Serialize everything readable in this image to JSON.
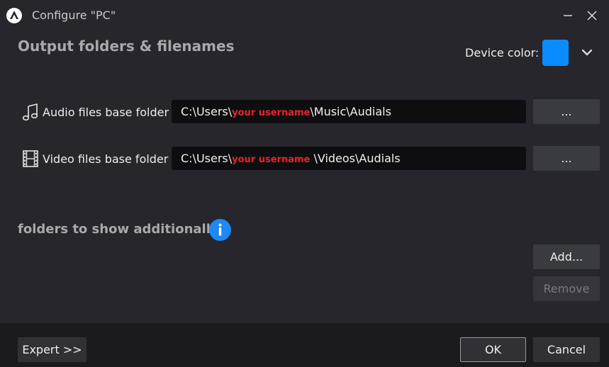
{
  "window": {
    "title": "Configure \"PC\"",
    "minimize_icon": "minimize-icon",
    "close_icon": "close-icon"
  },
  "header": {
    "section_title": "Output folders & filenames",
    "device_color_label": "Device color:",
    "device_color": "#0a8cff"
  },
  "folders": {
    "audio": {
      "icon": "music-note-icon",
      "label": "Audio files base folder",
      "path_prefix": "C:\\Users\\",
      "path_redacted": "your username",
      "path_suffix": "\\Music\\Audials",
      "browse_label": "..."
    },
    "video": {
      "icon": "film-strip-icon",
      "label": "Video files base folder",
      "path_prefix": "C:\\Users\\",
      "path_redacted": "your username",
      "path_suffix": " \\Videos\\Audials",
      "browse_label": "..."
    }
  },
  "additional": {
    "title": "folders to show additionally",
    "info_icon": "info-icon",
    "add_label": "Add...",
    "remove_label": "Remove"
  },
  "footer": {
    "expert_label": "Expert >>",
    "ok_label": "OK",
    "cancel_label": "Cancel"
  },
  "colors": {
    "background": "#26262c",
    "footer_background": "#1b1b1f",
    "field_background": "#0e0e10",
    "button_background": "#3a3a41",
    "accent_blue": "#0a8cff",
    "redaction_red": "#e8252d"
  }
}
